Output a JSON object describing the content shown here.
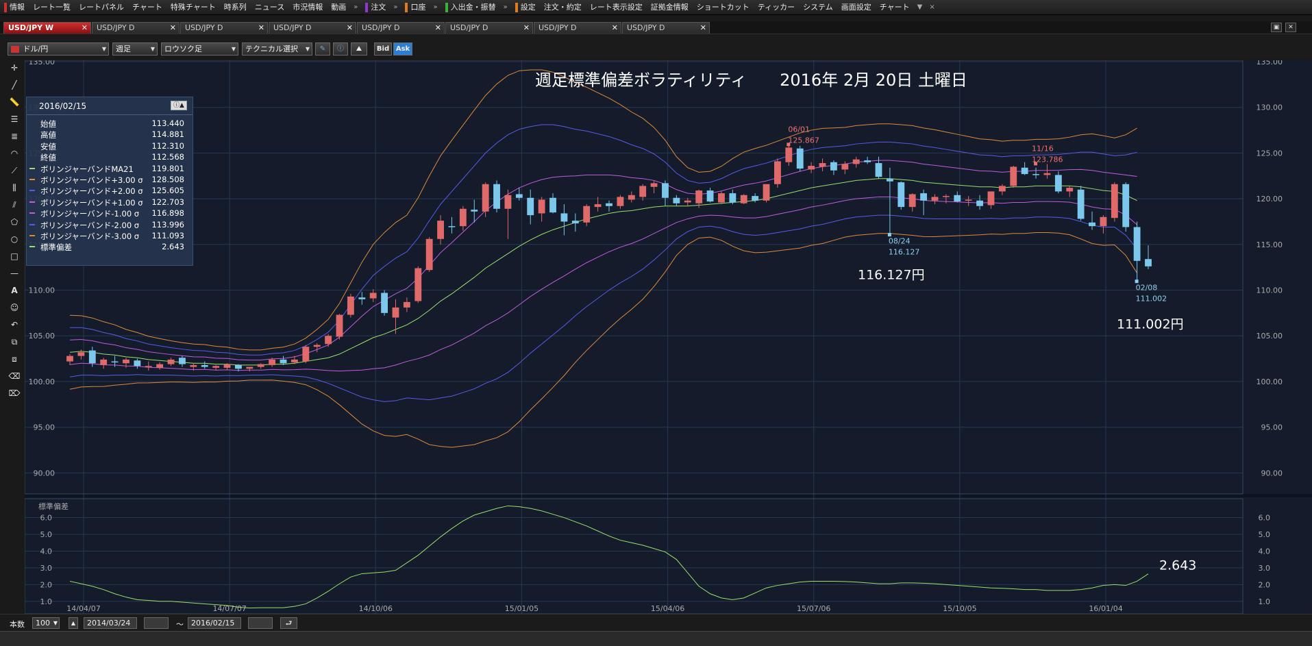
{
  "menu": {
    "items": [
      "情報",
      "レート一覧",
      "レートパネル",
      "チャート",
      "特殊チャート",
      "時系列",
      "ニュース",
      "市況情報",
      "動画",
      "注文",
      "口座",
      "入出金・振替",
      "設定",
      "注文・約定",
      "レート表示設定",
      "証拠金情報",
      "ショートカット",
      "ティッカー",
      "システム",
      "画面設定",
      "チャート"
    ],
    "more_label": "▼",
    "close_label": "×"
  },
  "tabs": [
    {
      "label": "USD/JPY W",
      "active": true
    },
    {
      "label": "USD/JPY D",
      "active": false
    },
    {
      "label": "USD/JPY D",
      "active": false
    },
    {
      "label": "USD/JPY D",
      "active": false
    },
    {
      "label": "USD/JPY D",
      "active": false
    },
    {
      "label": "USD/JPY D",
      "active": false
    },
    {
      "label": "USD/JPY D",
      "active": false
    },
    {
      "label": "USD/JPY D",
      "active": false
    }
  ],
  "toolbar": {
    "pair": "ドル/円",
    "period": "週足",
    "chart_type": "ロウソク足",
    "technical": "テクニカル選択",
    "bid_label": "Bid",
    "ask_label": "Ask"
  },
  "chart_title": "週足標準偏差ボラティリティ　　2016年 2月 20日 土曜日",
  "info_box": {
    "date": "2016/02/15",
    "rows": [
      {
        "label": "始値",
        "value": "113.440",
        "color": ""
      },
      {
        "label": "高値",
        "value": "114.881",
        "color": ""
      },
      {
        "label": "安値",
        "value": "112.310",
        "color": ""
      },
      {
        "label": "終値",
        "value": "112.568",
        "color": ""
      },
      {
        "label": "ボリンジャーバンドMA21",
        "value": "119.801",
        "color": "#9be06a"
      },
      {
        "label": "ボリンジャーバンド+3.00 σ",
        "value": "128.508",
        "color": "#e08a3a"
      },
      {
        "label": "ボリンジャーバンド+2.00 σ",
        "value": "125.605",
        "color": "#5a5ae8"
      },
      {
        "label": "ボリンジャーバンド+1.00 σ",
        "value": "122.703",
        "color": "#c45ae0"
      },
      {
        "label": "ボリンジャーバンド-1.00 σ",
        "value": "116.898",
        "color": "#c45ae0"
      },
      {
        "label": "ボリンジャーバンド-2.00 σ",
        "value": "113.996",
        "color": "#5a5ae8"
      },
      {
        "label": "ボリンジャーバンド-3.00 σ",
        "value": "111.093",
        "color": "#e08a3a"
      },
      {
        "label": "標準偏差",
        "value": "2.643",
        "color": "#9be06a"
      }
    ]
  },
  "annotations": {
    "high1_date": "06/01",
    "high1_value": "125.867",
    "high2_date": "11/16",
    "high2_value": "123.786",
    "low1_date": "08/24",
    "low1_value": "116.127",
    "low2_date": "02/08",
    "low2_value": "111.002",
    "big_low1": "116.127円",
    "big_low2": "111.002円",
    "big_std": "2.643"
  },
  "main_axis": {
    "ticks": [
      "135.00",
      "130.00",
      "125.00",
      "120.00",
      "115.00",
      "110.00",
      "105.00",
      "100.00",
      "95.00",
      "90.00"
    ]
  },
  "sub_panel": {
    "label": "標準偏差",
    "ticks": [
      "6.0",
      "5.0",
      "4.0",
      "3.0",
      "2.0",
      "1.0"
    ]
  },
  "x_axis": {
    "labels": [
      "14/04/07",
      "14/07/07",
      "14/10/06",
      "15/01/05",
      "15/04/06",
      "15/07/06",
      "15/10/05",
      "16/01/04"
    ]
  },
  "bottom": {
    "count_label": "本数",
    "count_value": "100",
    "start_date": "2014/03/24",
    "tilde": "〜",
    "end_date": "2016/02/15",
    "return_icon": "⮐"
  },
  "colors": {
    "up_candle": "#e06a6a",
    "down_candle": "#7cc8ec",
    "ma": "#9be06a",
    "sigma3": "#e08a3a",
    "sigma2": "#5a5ae8",
    "sigma1": "#c45ae0",
    "std": "#9be06a",
    "high_label": "#f07070",
    "low_label": "#8ecff0"
  },
  "chart_data": {
    "type": "candlestick",
    "title": "週足標準偏差ボラティリティ　　2016年 2月 20日 土曜日",
    "ylim": [
      88,
      135
    ],
    "sub_ylim": [
      0.5,
      6.8
    ],
    "candles": [
      [
        102.2,
        103.0,
        101.8,
        102.8
      ],
      [
        102.8,
        103.5,
        102.4,
        103.2
      ],
      [
        103.4,
        103.8,
        101.6,
        102.0
      ],
      [
        101.8,
        102.6,
        101.4,
        102.4
      ],
      [
        102.2,
        102.8,
        101.6,
        102.1
      ],
      [
        102.0,
        102.6,
        101.5,
        102.4
      ],
      [
        102.3,
        102.5,
        101.4,
        101.7
      ],
      [
        101.6,
        102.2,
        101.2,
        101.7
      ],
      [
        101.5,
        102.1,
        101.3,
        101.9
      ],
      [
        101.9,
        102.6,
        101.7,
        102.4
      ],
      [
        102.6,
        102.8,
        101.6,
        101.9
      ],
      [
        101.6,
        102.0,
        101.2,
        101.8
      ],
      [
        101.8,
        102.2,
        101.4,
        101.6
      ],
      [
        101.5,
        101.8,
        101.2,
        101.7
      ],
      [
        101.5,
        102.0,
        101.3,
        101.9
      ],
      [
        101.8,
        101.9,
        101.1,
        101.4
      ],
      [
        101.4,
        101.6,
        101.1,
        101.6
      ],
      [
        101.6,
        102.0,
        101.4,
        101.9
      ],
      [
        101.8,
        102.6,
        101.6,
        102.4
      ],
      [
        102.4,
        102.8,
        101.8,
        102.0
      ],
      [
        102.1,
        102.8,
        101.9,
        102.4
      ],
      [
        102.2,
        104.0,
        102.0,
        103.8
      ],
      [
        103.8,
        104.2,
        103.2,
        104.0
      ],
      [
        104.1,
        105.2,
        103.8,
        105.0
      ],
      [
        104.9,
        107.4,
        104.6,
        107.3
      ],
      [
        107.3,
        109.6,
        107.0,
        109.3
      ],
      [
        109.2,
        109.8,
        108.4,
        109.0
      ],
      [
        109.1,
        110.1,
        108.7,
        109.7
      ],
      [
        109.7,
        110.0,
        107.2,
        107.5
      ],
      [
        107.0,
        109.0,
        105.2,
        108.1
      ],
      [
        108.1,
        109.2,
        107.6,
        108.7
      ],
      [
        108.8,
        112.6,
        108.6,
        112.4
      ],
      [
        112.2,
        115.8,
        112.0,
        115.6
      ],
      [
        115.6,
        118.2,
        115.0,
        117.6
      ],
      [
        117.0,
        118.0,
        116.2,
        116.9
      ],
      [
        117.0,
        119.2,
        116.5,
        118.9
      ],
      [
        118.8,
        119.9,
        117.4,
        118.6
      ],
      [
        118.6,
        121.8,
        118.0,
        121.6
      ],
      [
        121.6,
        122.0,
        118.5,
        118.9
      ],
      [
        118.9,
        121.0,
        115.6,
        120.4
      ],
      [
        120.5,
        121.2,
        119.8,
        120.1
      ],
      [
        120.1,
        121.0,
        117.2,
        118.2
      ],
      [
        118.4,
        120.2,
        117.5,
        119.9
      ],
      [
        120.1,
        120.6,
        118.4,
        118.5
      ],
      [
        118.4,
        119.4,
        116.0,
        117.5
      ],
      [
        117.6,
        118.4,
        116.4,
        117.3
      ],
      [
        117.4,
        119.4,
        117.0,
        119.2
      ],
      [
        119.1,
        120.2,
        118.6,
        119.4
      ],
      [
        119.5,
        119.8,
        118.6,
        119.2
      ],
      [
        119.2,
        120.4,
        118.9,
        120.2
      ],
      [
        119.9,
        120.8,
        119.6,
        120.4
      ],
      [
        120.2,
        121.6,
        119.8,
        121.4
      ],
      [
        121.3,
        122.0,
        120.6,
        121.7
      ],
      [
        121.7,
        122.0,
        119.2,
        120.1
      ],
      [
        120.1,
        120.4,
        119.2,
        119.5
      ],
      [
        119.6,
        120.1,
        119.2,
        119.8
      ],
      [
        119.5,
        121.0,
        119.0,
        120.9
      ],
      [
        120.9,
        121.2,
        119.6,
        119.7
      ],
      [
        119.6,
        120.8,
        119.4,
        120.6
      ],
      [
        120.6,
        121.0,
        119.4,
        119.6
      ],
      [
        119.5,
        120.5,
        119.4,
        120.4
      ],
      [
        120.3,
        120.6,
        119.6,
        119.8
      ],
      [
        119.8,
        121.6,
        119.6,
        121.6
      ],
      [
        121.6,
        124.4,
        121.2,
        124.1
      ],
      [
        124.0,
        125.9,
        123.6,
        125.6
      ],
      [
        125.5,
        125.8,
        123.0,
        123.3
      ],
      [
        123.2,
        124.0,
        122.8,
        123.6
      ],
      [
        123.5,
        124.4,
        123.0,
        123.9
      ],
      [
        124.0,
        124.2,
        122.6,
        123.1
      ],
      [
        123.2,
        124.1,
        122.7,
        123.8
      ],
      [
        123.8,
        124.6,
        123.4,
        124.3
      ],
      [
        124.2,
        124.6,
        123.8,
        124.0
      ],
      [
        123.9,
        124.6,
        122.2,
        122.4
      ],
      [
        122.2,
        123.4,
        116.1,
        121.9
      ],
      [
        121.8,
        121.9,
        118.8,
        119.1
      ],
      [
        119.1,
        120.6,
        118.6,
        120.5
      ],
      [
        120.6,
        121.0,
        118.2,
        119.8
      ],
      [
        119.8,
        120.5,
        119.4,
        120.2
      ],
      [
        120.2,
        120.5,
        119.5,
        120.3
      ],
      [
        120.4,
        120.8,
        119.6,
        119.7
      ],
      [
        119.8,
        120.3,
        119.2,
        119.9
      ],
      [
        119.8,
        120.4,
        118.8,
        119.2
      ],
      [
        119.3,
        120.8,
        118.9,
        120.8
      ],
      [
        120.8,
        121.6,
        120.4,
        121.4
      ],
      [
        121.4,
        123.6,
        121.2,
        123.5
      ],
      [
        123.4,
        124.0,
        122.6,
        122.7
      ],
      [
        122.7,
        123.4,
        122.2,
        122.6
      ],
      [
        122.6,
        123.8,
        122.2,
        122.8
      ],
      [
        122.6,
        123.0,
        120.6,
        120.8
      ],
      [
        120.8,
        121.4,
        120.2,
        121.2
      ],
      [
        121.0,
        121.4,
        117.6,
        117.8
      ],
      [
        117.4,
        118.6,
        116.6,
        117.0
      ],
      [
        117.0,
        118.2,
        116.2,
        118.0
      ],
      [
        117.9,
        121.8,
        117.5,
        121.6
      ],
      [
        121.6,
        121.8,
        116.4,
        116.9
      ],
      [
        116.9,
        117.5,
        110.9,
        113.2
      ],
      [
        113.4,
        114.9,
        112.3,
        112.6
      ]
    ],
    "bands": {
      "ma": [
        103.2,
        103.3,
        103.2,
        103.0,
        102.9,
        102.7,
        102.6,
        102.4,
        102.3,
        102.2,
        102.1,
        102.0,
        102.0,
        101.9,
        101.9,
        101.8,
        101.8,
        101.8,
        101.9,
        101.9,
        102.0,
        102.2,
        102.4,
        102.6,
        103.0,
        103.6,
        104.2,
        104.8,
        105.2,
        105.7,
        106.2,
        106.9,
        107.8,
        108.8,
        109.6,
        110.5,
        111.4,
        112.4,
        113.2,
        114.0,
        114.8,
        115.5,
        116.1,
        116.6,
        117.0,
        117.4,
        117.8,
        118.1,
        118.4,
        118.6,
        118.7,
        118.9,
        119.1,
        119.2,
        119.2,
        119.2,
        119.3,
        119.4,
        119.5,
        119.6,
        119.7,
        119.8,
        120.0,
        120.3,
        120.6,
        120.9,
        121.2,
        121.4,
        121.6,
        121.8,
        122.0,
        122.1,
        122.2,
        122.2,
        122.1,
        122.0,
        121.8,
        121.7,
        121.6,
        121.5,
        121.4,
        121.3,
        121.3,
        121.2,
        121.3,
        121.3,
        121.4,
        121.4,
        121.4,
        121.4,
        121.3,
        121.1,
        120.9,
        120.8,
        120.4,
        119.8
      ],
      "sd": [
        1.35,
        1.3,
        1.25,
        1.18,
        1.1,
        1.0,
        0.92,
        0.85,
        0.8,
        0.75,
        0.72,
        0.7,
        0.68,
        0.65,
        0.62,
        0.58,
        0.55,
        0.55,
        0.58,
        0.62,
        0.7,
        0.85,
        1.1,
        1.4,
        1.85,
        2.4,
        2.95,
        3.4,
        3.7,
        3.9,
        4.0,
        4.4,
        4.9,
        5.3,
        5.6,
        5.85,
        6.1,
        6.3,
        6.45,
        6.5,
        6.4,
        6.2,
        6.0,
        5.75,
        5.45,
        5.1,
        4.8,
        4.5,
        4.2,
        3.9,
        3.6,
        3.3,
        2.9,
        2.4,
        1.8,
        1.4,
        1.2,
        1.2,
        1.35,
        1.6,
        1.8,
        1.9,
        1.95,
        2.0,
        2.05,
        2.1,
        2.1,
        2.1,
        2.05,
        2.0,
        2.0,
        2.0,
        2.0,
        2.0,
        2.0,
        2.0,
        1.98,
        1.95,
        1.9,
        1.85,
        1.8,
        1.75,
        1.72,
        1.7,
        1.7,
        1.7,
        1.7,
        1.7,
        1.72,
        1.78,
        1.9,
        2.0,
        2.0,
        1.95,
        2.2,
        2.64
      ]
    },
    "std_series": [
      2.2,
      2.05,
      1.9,
      1.7,
      1.45,
      1.25,
      1.1,
      1.05,
      1.0,
      1.0,
      0.95,
      0.9,
      0.85,
      0.8,
      0.75,
      0.65,
      0.6,
      0.62,
      0.62,
      0.62,
      0.7,
      0.85,
      1.2,
      1.6,
      2.05,
      2.45,
      2.65,
      2.7,
      2.75,
      2.85,
      3.3,
      3.75,
      4.3,
      4.85,
      5.35,
      5.8,
      6.15,
      6.35,
      6.55,
      6.7,
      6.65,
      6.55,
      6.4,
      6.2,
      6.0,
      5.75,
      5.5,
      5.2,
      4.9,
      4.65,
      4.5,
      4.35,
      4.15,
      3.95,
      3.5,
      2.7,
      1.9,
      1.45,
      1.2,
      1.1,
      1.2,
      1.5,
      1.8,
      1.95,
      2.05,
      2.15,
      2.2,
      2.2,
      2.2,
      2.18,
      2.15,
      2.1,
      2.05,
      2.05,
      2.1,
      2.1,
      2.08,
      2.05,
      2.0,
      1.95,
      1.9,
      1.85,
      1.8,
      1.78,
      1.75,
      1.7,
      1.7,
      1.65,
      1.65,
      1.65,
      1.7,
      1.8,
      1.95,
      2.0,
      1.95,
      2.2,
      2.64
    ],
    "x_labels": [
      "14/04/07",
      "14/07/07",
      "14/10/06",
      "15/01/05",
      "15/04/06",
      "15/07/06",
      "15/10/05",
      "16/01/04"
    ]
  }
}
